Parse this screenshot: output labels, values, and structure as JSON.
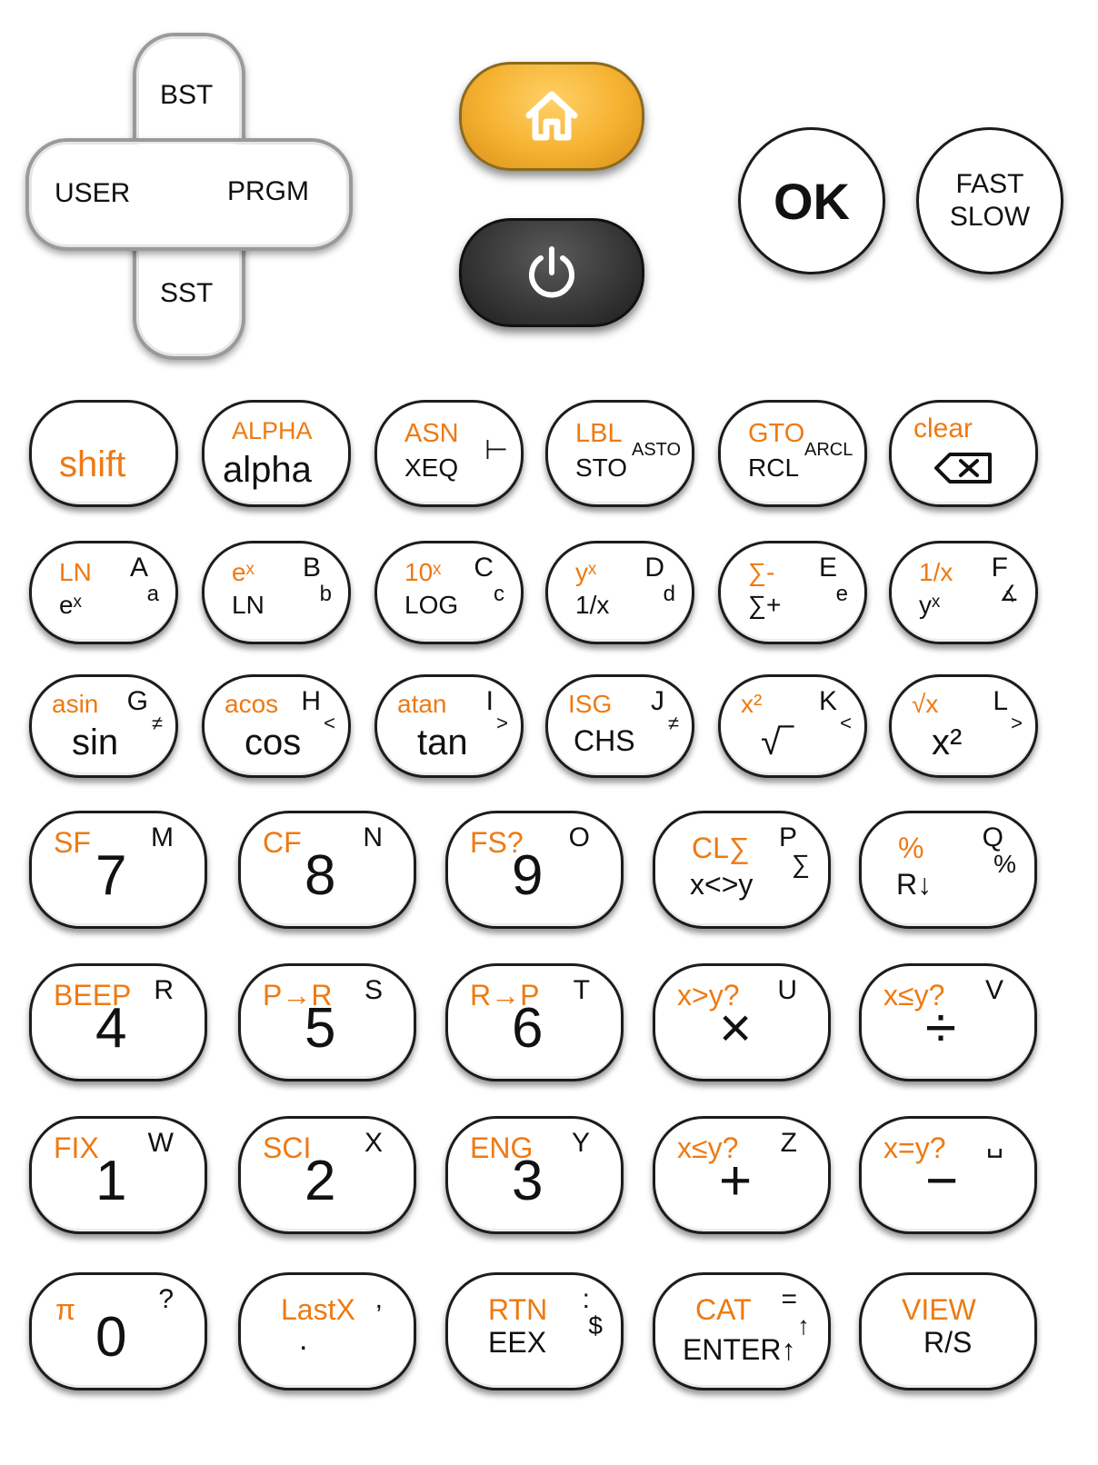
{
  "nav_pad": {
    "up": "BST",
    "left": "USER",
    "right": "PRGM",
    "down": "SST"
  },
  "top_buttons": {
    "ok": "OK",
    "fast_slow": "FAST\nSLOW"
  },
  "icons": {
    "home": "home-icon",
    "power": "power-icon",
    "backspace": "backspace-icon"
  },
  "colors": {
    "shifted": "#ee7a12",
    "home": "#f5b231",
    "power": "#2a2a2a",
    "text": "#111111"
  },
  "rows": [
    [
      {
        "shift": "shift"
      },
      {
        "shift": "ALPHA",
        "main": "alpha"
      },
      {
        "shift": "ASN",
        "main": "XEQ",
        "alpha": "⊢"
      },
      {
        "shift": "LBL",
        "main": "STO",
        "alpha": "ASTO"
      },
      {
        "shift": "GTO",
        "main": "RCL",
        "alpha": "ARCL"
      },
      {
        "shift": "clear"
      }
    ],
    [
      {
        "shift": "LN",
        "main": "eˣ",
        "letter": "A",
        "alpha": "a"
      },
      {
        "shift": "eˣ",
        "main": "LN",
        "letter": "B",
        "alpha": "b"
      },
      {
        "shift": "10ˣ",
        "main": "LOG",
        "letter": "C",
        "alpha": "c"
      },
      {
        "shift": "yˣ",
        "main": "1/x",
        "letter": "D",
        "alpha": "d"
      },
      {
        "shift": "∑-",
        "main": "∑+",
        "letter": "E",
        "alpha": "e"
      },
      {
        "shift": "1/x",
        "main": "yˣ",
        "letter": "F",
        "alpha": "∡"
      }
    ],
    [
      {
        "shift": "asin",
        "main": "sin",
        "letter": "G",
        "alpha": "≠"
      },
      {
        "shift": "acos",
        "main": "cos",
        "letter": "H",
        "alpha": "<"
      },
      {
        "shift": "atan",
        "main": "tan",
        "letter": "I",
        "alpha": ">"
      },
      {
        "shift": "ISG",
        "main": "CHS",
        "letter": "J",
        "alpha": "≠"
      },
      {
        "shift": "x²",
        "main": "√‾",
        "letter": "K",
        "alpha": "<"
      },
      {
        "shift": "√x",
        "main": "x²",
        "letter": "L",
        "alpha": ">"
      }
    ],
    [
      {
        "shift": "SF",
        "main": "7",
        "letter": "M"
      },
      {
        "shift": "CF",
        "main": "8",
        "letter": "N"
      },
      {
        "shift": "FS?",
        "main": "9",
        "letter": "O"
      },
      {
        "shift": "CL∑",
        "main": "x<>y",
        "letter": "P",
        "alpha": "∑"
      },
      {
        "shift": "%",
        "main": "R↓",
        "letter": "Q",
        "alpha": "%"
      }
    ],
    [
      {
        "shift": "BEEP",
        "main": "4",
        "letter": "R"
      },
      {
        "shift": "P→R",
        "main": "5",
        "letter": "S"
      },
      {
        "shift": "R→P",
        "main": "6",
        "letter": "T"
      },
      {
        "shift": "x>y?",
        "main": "×",
        "letter": "U"
      },
      {
        "shift": "x≤y?",
        "main": "÷",
        "letter": "V"
      }
    ],
    [
      {
        "shift": "FIX",
        "main": "1",
        "letter": "W"
      },
      {
        "shift": "SCI",
        "main": "2",
        "letter": "X"
      },
      {
        "shift": "ENG",
        "main": "3",
        "letter": "Y"
      },
      {
        "shift": "x≤y?",
        "main": "+",
        "letter": "Z"
      },
      {
        "shift": "x=y?",
        "main": "−",
        "letter": "␣"
      }
    ],
    [
      {
        "shift": "π",
        "main": "0",
        "letter": "?"
      },
      {
        "shift": "LastX",
        "main": ".",
        "letter": ","
      },
      {
        "shift": "RTN",
        "main": "EEX",
        "letter": ":",
        "alpha": "$"
      },
      {
        "shift": "CAT",
        "main": "ENTER↑",
        "letter": "=",
        "alpha": "↑"
      },
      {
        "shift": "VIEW",
        "main": "R/S"
      }
    ]
  ]
}
